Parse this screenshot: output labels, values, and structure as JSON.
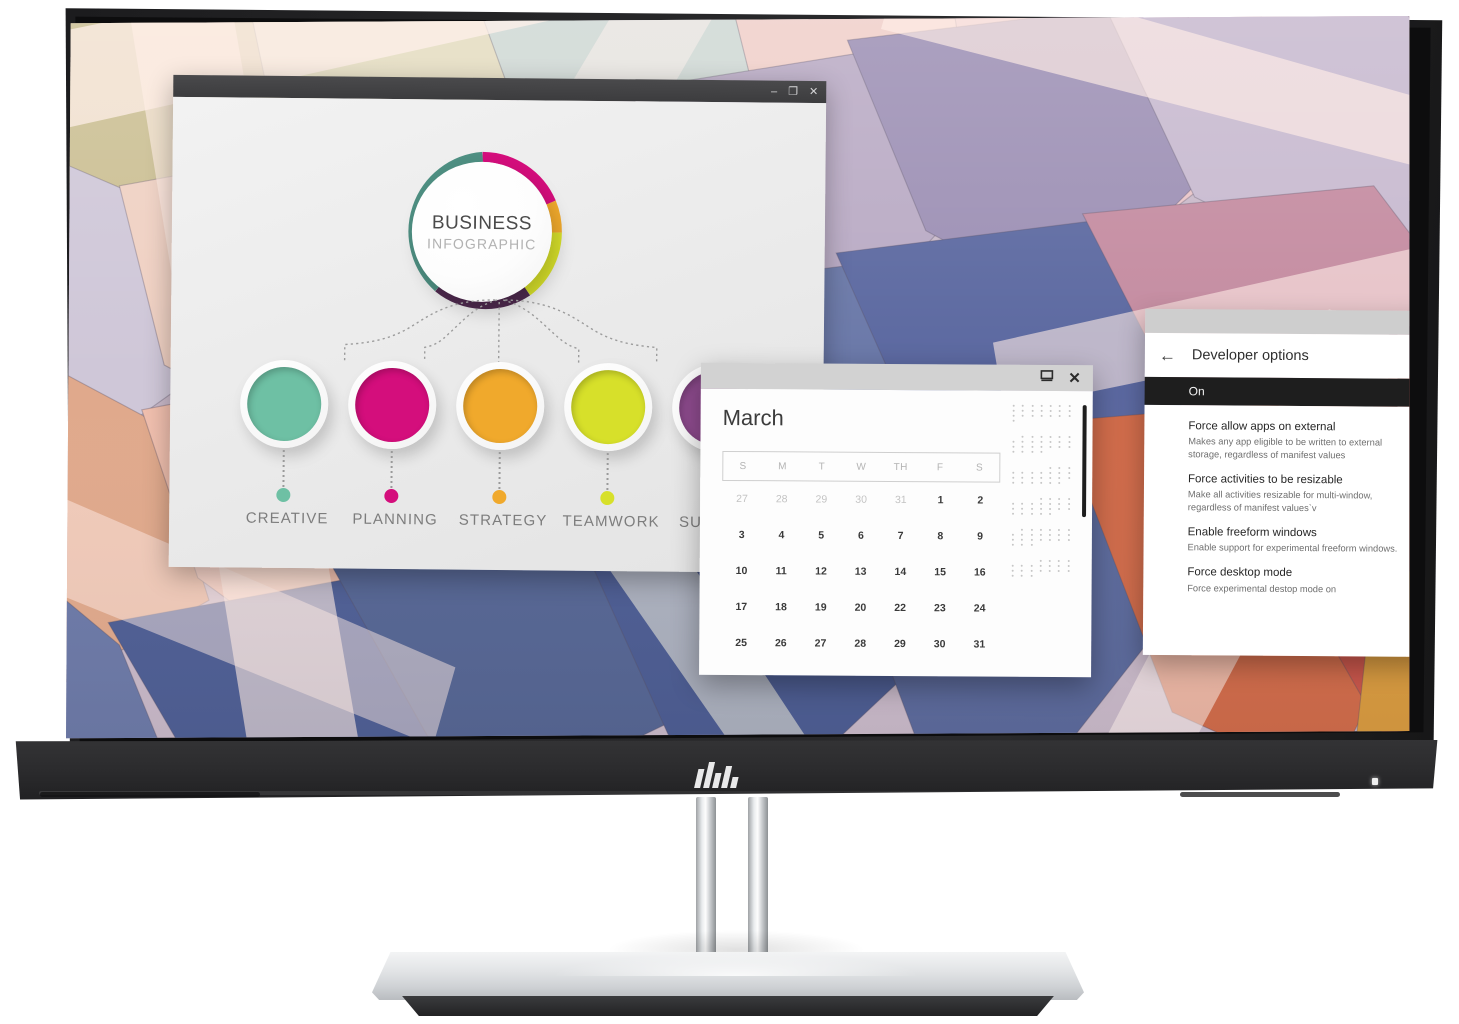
{
  "device": {
    "brand_logo": "hp-logo",
    "power_indicator": "power-led"
  },
  "infographic_window": {
    "titlebar": {
      "minimize": "–",
      "maximize": "❐",
      "close": "✕"
    },
    "center": {
      "title": "BUSINESS",
      "subtitle": "INFOGRAPHIC"
    },
    "nodes": [
      {
        "label": "CREATIVE",
        "color": "#6ec0a4"
      },
      {
        "label": "PLANNING",
        "color": "#d40e7c"
      },
      {
        "label": "STRATEGY",
        "color": "#f0a92c"
      },
      {
        "label": "TEAMWORK",
        "color": "#d7e02a"
      },
      {
        "label": "SUCCESS",
        "color": "#8e4b8e"
      }
    ],
    "ring_colors": [
      "#d40e7c",
      "#f0a92c",
      "#d7e02a",
      "#4f2a4f",
      "#4e8f82"
    ]
  },
  "calendar_window": {
    "titlebar": {
      "restore": "▣",
      "close": "✕"
    },
    "month": "March",
    "weekday_headers": [
      "S",
      "M",
      "T",
      "W",
      "TH",
      "F",
      "S"
    ],
    "weeks": [
      [
        {
          "d": "27",
          "muted": true
        },
        {
          "d": "28",
          "muted": true
        },
        {
          "d": "29",
          "muted": true
        },
        {
          "d": "30",
          "muted": true
        },
        {
          "d": "31",
          "muted": true
        },
        {
          "d": "1",
          "muted": false
        },
        {
          "d": "2",
          "muted": false
        }
      ],
      [
        {
          "d": "3",
          "muted": false
        },
        {
          "d": "4",
          "muted": false
        },
        {
          "d": "5",
          "muted": false
        },
        {
          "d": "6",
          "muted": false
        },
        {
          "d": "7",
          "muted": false
        },
        {
          "d": "8",
          "muted": false
        },
        {
          "d": "9",
          "muted": false
        }
      ],
      [
        {
          "d": "10",
          "muted": false
        },
        {
          "d": "11",
          "muted": false
        },
        {
          "d": "12",
          "muted": false
        },
        {
          "d": "13",
          "muted": false
        },
        {
          "d": "14",
          "muted": false
        },
        {
          "d": "15",
          "muted": false
        },
        {
          "d": "16",
          "muted": false
        }
      ],
      [
        {
          "d": "17",
          "muted": false
        },
        {
          "d": "18",
          "muted": false
        },
        {
          "d": "19",
          "muted": false
        },
        {
          "d": "20",
          "muted": false
        },
        {
          "d": "22",
          "muted": false
        },
        {
          "d": "23",
          "muted": false
        },
        {
          "d": "24",
          "muted": false
        }
      ],
      [
        {
          "d": "25",
          "muted": false
        },
        {
          "d": "26",
          "muted": false
        },
        {
          "d": "27",
          "muted": false
        },
        {
          "d": "28",
          "muted": false
        },
        {
          "d": "29",
          "muted": false
        },
        {
          "d": "30",
          "muted": false
        },
        {
          "d": "31",
          "muted": false
        }
      ]
    ]
  },
  "developer_options_window": {
    "titlebar": {
      "restore": "▣",
      "close": "✕"
    },
    "back_arrow": "←",
    "title": "Developer options",
    "master_state": "On",
    "settings": [
      {
        "title": "Force allow apps on external",
        "summary": "Makes any app eligible to be written to external storage, regardless of manifest values",
        "toggle": "on"
      },
      {
        "title": "Force activities to be resizable",
        "summary": "Make all activities resizable for multi-window, regardless of manifest values`v",
        "toggle": "on"
      },
      {
        "title": "Enable freeform windows",
        "summary": "Enable support for experimental freeform windows.",
        "toggle": "on"
      },
      {
        "title": "Force desktop mode",
        "summary": "Force experimental destop mode on",
        "toggle": "on"
      }
    ]
  }
}
